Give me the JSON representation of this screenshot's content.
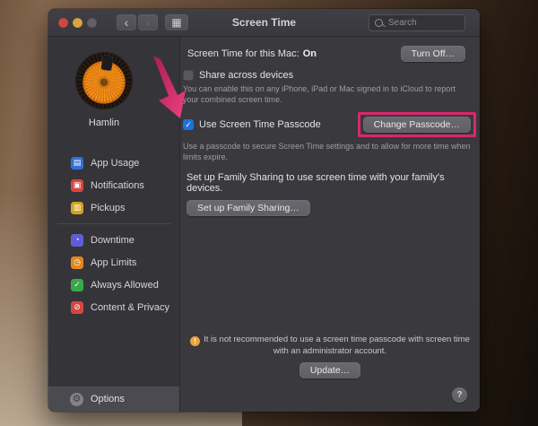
{
  "titlebar": {
    "title": "Screen Time",
    "back_icon": "‹",
    "forward_icon": "›",
    "grid_icon": "▦",
    "search_placeholder": "Search"
  },
  "sidebar": {
    "user_name": "Hamlin",
    "items": [
      {
        "label": "App Usage",
        "glyph": "▤",
        "color": "#2f6ed6"
      },
      {
        "label": "Notifications",
        "glyph": "▣",
        "color": "#d6453f"
      },
      {
        "label": "Pickups",
        "glyph": "▥",
        "color": "#d3a21b"
      },
      {
        "label": "Downtime",
        "glyph": "◔",
        "color": "#5e5cd6"
      },
      {
        "label": "App Limits",
        "glyph": "◷",
        "color": "#e2851c"
      },
      {
        "label": "Always Allowed",
        "glyph": "✓",
        "color": "#37a846"
      },
      {
        "label": "Content & Privacy",
        "glyph": "⊘",
        "color": "#d6453f"
      }
    ],
    "options": {
      "label": "Options",
      "glyph": "⚙"
    }
  },
  "content": {
    "status_label": "Screen Time for this Mac:",
    "status_value": "On",
    "turn_off_button": "Turn Off…",
    "share_checkbox": "Share across devices",
    "share_caption": "You can enable this on any iPhone, iPad or Mac signed in to iCloud to report your combined screen time.",
    "passcode_checkbox": "Use Screen Time Passcode",
    "passcode_check_glyph": "✓",
    "change_passcode_button": "Change Passcode…",
    "passcode_caption": "Use a passcode to secure Screen Time settings and to allow for more time when limits expire.",
    "family_text": "Set up Family Sharing to use screen time with your family's devices.",
    "family_button": "Set up Family Sharing…",
    "warning_icon": "!",
    "warning_text": "It is not recommended to use a screen time passcode with screen time with an administrator account.",
    "update_button": "Update…",
    "help_button": "?"
  },
  "colors": {
    "annotation_pink": "#d8286d",
    "checkbox_blue": "#1f6fe0",
    "warning_orange": "#e8a33d",
    "window_background": "#39383c"
  }
}
